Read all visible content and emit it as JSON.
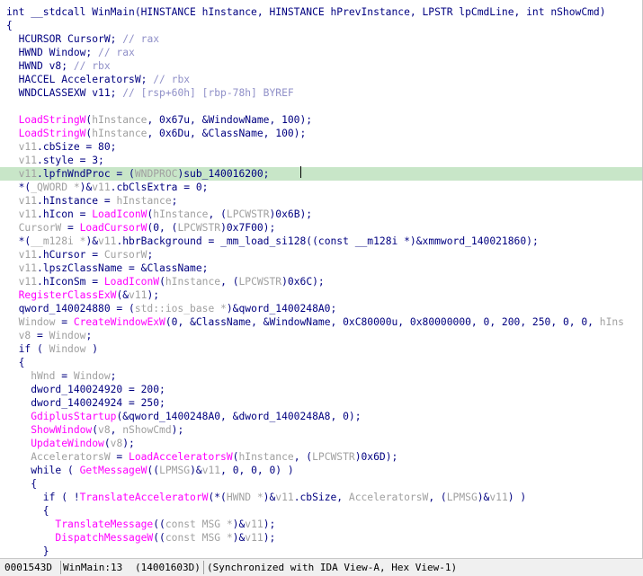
{
  "editor": {
    "lines": [
      [
        [
          "kw",
          "int __stdcall WinMain(HINSTANCE hInstance, HINSTANCE hPrevInstance, LPSTR lpCmdLine, int nShowCmd)"
        ]
      ],
      [
        [
          "kw",
          "{"
        ]
      ],
      [
        [
          "kw",
          "  HCURSOR CursorW; "
        ],
        [
          "cm",
          "// rax"
        ]
      ],
      [
        [
          "kw",
          "  HWND Window; "
        ],
        [
          "cm",
          "// rax"
        ]
      ],
      [
        [
          "kw",
          "  HWND v8; "
        ],
        [
          "cm",
          "// rbx"
        ]
      ],
      [
        [
          "kw",
          "  HACCEL AcceleratorsW; "
        ],
        [
          "cm",
          "// rbx"
        ]
      ],
      [
        [
          "kw",
          "  WNDCLASSEXW v11; "
        ],
        [
          "cm",
          "// [rsp+60h] [rbp-78h] BYREF"
        ]
      ],
      [
        [
          "kw",
          ""
        ]
      ],
      [
        [
          "fn",
          "  LoadStringW"
        ],
        [
          "kw",
          "("
        ],
        [
          "gv",
          "hInstance"
        ],
        [
          "kw",
          ", 0x67u, &WindowName, 100);"
        ]
      ],
      [
        [
          "fn",
          "  LoadStringW"
        ],
        [
          "kw",
          "("
        ],
        [
          "gv",
          "hInstance"
        ],
        [
          "kw",
          ", 0x6Du, &ClassName, 100);"
        ]
      ],
      [
        [
          "gv",
          "  v11"
        ],
        [
          "kw",
          ".cbSize = 80;"
        ]
      ],
      [
        [
          "gv",
          "  v11"
        ],
        [
          "kw",
          ".style = 3;"
        ]
      ],
      [
        [
          "gv",
          "  v11"
        ],
        [
          "kw",
          ".lpfnWndProc = ("
        ],
        [
          "typ",
          "WNDPROC"
        ],
        [
          "kw",
          ")sub_140016200;"
        ]
      ],
      [
        [
          "kw",
          "  *("
        ],
        [
          "typ",
          "_QWORD *"
        ],
        [
          "kw",
          ")&"
        ],
        [
          "gv",
          "v11"
        ],
        [
          "kw",
          ".cbClsExtra = 0;"
        ]
      ],
      [
        [
          "gv",
          "  v11"
        ],
        [
          "kw",
          ".hInstance = "
        ],
        [
          "gv",
          "hInstance"
        ],
        [
          "kw",
          ";"
        ]
      ],
      [
        [
          "gv",
          "  v11"
        ],
        [
          "kw",
          ".hIcon = "
        ],
        [
          "fn",
          "LoadIconW"
        ],
        [
          "kw",
          "("
        ],
        [
          "gv",
          "hInstance"
        ],
        [
          "kw",
          ", ("
        ],
        [
          "typ",
          "LPCWSTR"
        ],
        [
          "kw",
          ")0x6B);"
        ]
      ],
      [
        [
          "gv",
          "  CursorW"
        ],
        [
          "kw",
          " = "
        ],
        [
          "fn",
          "LoadCursorW"
        ],
        [
          "kw",
          "(0, ("
        ],
        [
          "typ",
          "LPCWSTR"
        ],
        [
          "kw",
          ")0x7F00);"
        ]
      ],
      [
        [
          "kw",
          "  *("
        ],
        [
          "typ",
          "__m128i *"
        ],
        [
          "kw",
          ")&"
        ],
        [
          "gv",
          "v11"
        ],
        [
          "kw",
          ".hbrBackground = _mm_load_si128((const __m128i *)&xmmword_140021860);"
        ]
      ],
      [
        [
          "gv",
          "  v11"
        ],
        [
          "kw",
          ".hCursor = "
        ],
        [
          "gv",
          "CursorW"
        ],
        [
          "kw",
          ";"
        ]
      ],
      [
        [
          "gv",
          "  v11"
        ],
        [
          "kw",
          ".lpszClassName = &ClassName;"
        ]
      ],
      [
        [
          "gv",
          "  v11"
        ],
        [
          "kw",
          ".hIconSm = "
        ],
        [
          "fn",
          "LoadIconW"
        ],
        [
          "kw",
          "("
        ],
        [
          "gv",
          "hInstance"
        ],
        [
          "kw",
          ", ("
        ],
        [
          "typ",
          "LPCWSTR"
        ],
        [
          "kw",
          ")0x6C);"
        ]
      ],
      [
        [
          "fn",
          "  RegisterClassExW"
        ],
        [
          "kw",
          "(&"
        ],
        [
          "gv",
          "v11"
        ],
        [
          "kw",
          ");"
        ]
      ],
      [
        [
          "kw",
          "  qword_140024880 = ("
        ],
        [
          "typ",
          "std::ios_base *"
        ],
        [
          "kw",
          ")&qword_1400248A0;"
        ]
      ],
      [
        [
          "gv",
          "  Window"
        ],
        [
          "kw",
          " = "
        ],
        [
          "fn",
          "CreateWindowExW"
        ],
        [
          "kw",
          "(0, &ClassName, &WindowName, 0xC80000u, 0x80000000, 0, 200, 250, 0, 0, "
        ],
        [
          "gv",
          "hIns"
        ]
      ],
      [
        [
          "gv",
          "  v8"
        ],
        [
          "kw",
          " = "
        ],
        [
          "gv",
          "Window"
        ],
        [
          "kw",
          ";"
        ]
      ],
      [
        [
          "kw",
          "  if ( "
        ],
        [
          "gv",
          "Window"
        ],
        [
          "kw",
          " )"
        ]
      ],
      [
        [
          "kw",
          "  {"
        ]
      ],
      [
        [
          "gv",
          "    hWnd"
        ],
        [
          "kw",
          " = "
        ],
        [
          "gv",
          "Window"
        ],
        [
          "kw",
          ";"
        ]
      ],
      [
        [
          "kw",
          "    dword_140024920 = 200;"
        ]
      ],
      [
        [
          "kw",
          "    dword_140024924 = 250;"
        ]
      ],
      [
        [
          "fn",
          "    GdiplusStartup"
        ],
        [
          "kw",
          "(&qword_1400248A0, &dword_1400248A8, 0);"
        ]
      ],
      [
        [
          "fn",
          "    ShowWindow"
        ],
        [
          "kw",
          "("
        ],
        [
          "gv",
          "v8"
        ],
        [
          "kw",
          ", "
        ],
        [
          "gv",
          "nShowCmd"
        ],
        [
          "kw",
          ");"
        ]
      ],
      [
        [
          "fn",
          "    UpdateWindow"
        ],
        [
          "kw",
          "("
        ],
        [
          "gv",
          "v8"
        ],
        [
          "kw",
          ");"
        ]
      ],
      [
        [
          "gv",
          "    AcceleratorsW"
        ],
        [
          "kw",
          " = "
        ],
        [
          "fn",
          "LoadAcceleratorsW"
        ],
        [
          "kw",
          "("
        ],
        [
          "gv",
          "hInstance"
        ],
        [
          "kw",
          ", ("
        ],
        [
          "typ",
          "LPCWSTR"
        ],
        [
          "kw",
          ")0x6D);"
        ]
      ],
      [
        [
          "kw",
          "    while ( "
        ],
        [
          "fn",
          "GetMessageW"
        ],
        [
          "kw",
          "(("
        ],
        [
          "typ",
          "LPMSG"
        ],
        [
          "kw",
          ")&"
        ],
        [
          "gv",
          "v11"
        ],
        [
          "kw",
          ", 0, 0, 0) )"
        ]
      ],
      [
        [
          "kw",
          "    {"
        ]
      ],
      [
        [
          "kw",
          "      if ( !"
        ],
        [
          "fn",
          "TranslateAcceleratorW"
        ],
        [
          "kw",
          "(*("
        ],
        [
          "typ",
          "HWND *"
        ],
        [
          "kw",
          ")&"
        ],
        [
          "gv",
          "v11"
        ],
        [
          "kw",
          ".cbSize, "
        ],
        [
          "gv",
          "AcceleratorsW"
        ],
        [
          "kw",
          ", ("
        ],
        [
          "typ",
          "LPMSG"
        ],
        [
          "kw",
          ")&"
        ],
        [
          "gv",
          "v11"
        ],
        [
          "kw",
          ") )"
        ]
      ],
      [
        [
          "kw",
          "      {"
        ]
      ],
      [
        [
          "fn",
          "        TranslateMessage"
        ],
        [
          "kw",
          "(("
        ],
        [
          "typ",
          "const MSG *"
        ],
        [
          "kw",
          ")&"
        ],
        [
          "gv",
          "v11"
        ],
        [
          "kw",
          ");"
        ]
      ],
      [
        [
          "fn",
          "        DispatchMessageW"
        ],
        [
          "kw",
          "(("
        ],
        [
          "typ",
          "const MSG *"
        ],
        [
          "kw",
          ")&"
        ],
        [
          "gv",
          "v11"
        ],
        [
          "kw",
          ");"
        ]
      ],
      [
        [
          "kw",
          "      }"
        ]
      ]
    ],
    "highlighted_line": 12
  },
  "status_bar": {
    "address": "0001543D",
    "location": "WinMain:13",
    "ea": "(14001603D)",
    "sync": "(Synchronized with IDA View-A, Hex View-1)"
  }
}
